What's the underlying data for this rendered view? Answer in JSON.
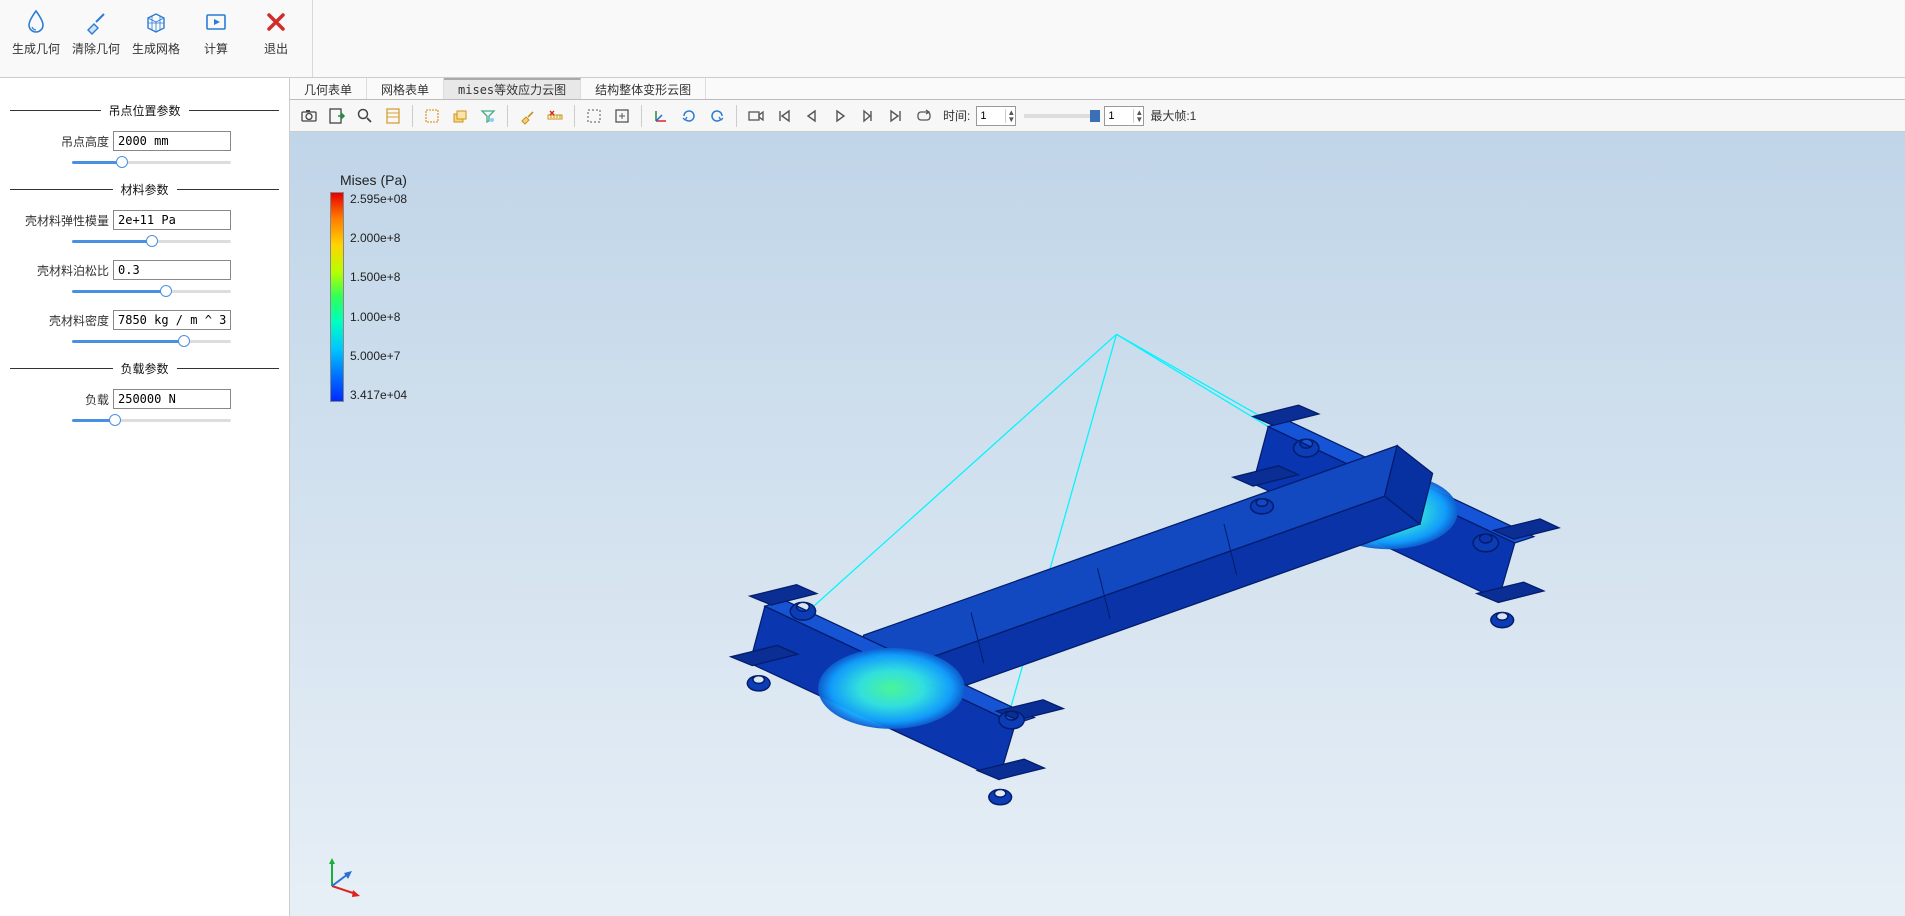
{
  "ribbon": {
    "generate_geom": "生成几何",
    "clear_geom": "清除几何",
    "generate_mesh": "生成网格",
    "compute": "计算",
    "exit": "退出"
  },
  "sidebar": {
    "group1_title": "吊点位置参数",
    "hang_height_label": "吊点高度",
    "hang_height_value": "2000 mm",
    "group2_title": "材料参数",
    "elastic_label": "壳材料弹性模量",
    "elastic_value": "2e+11 Pa",
    "poisson_label": "壳材料泊松比",
    "poisson_value": "0.3",
    "density_label": "壳材料密度",
    "density_value": "7850 kg / m ^ 3",
    "group3_title": "负载参数",
    "load_label": "负载",
    "load_value": "250000 N"
  },
  "tabs": {
    "t1": "几何表单",
    "t2": "网格表单",
    "t3": "mises等效应力云图",
    "t4": "结构整体变形云图"
  },
  "vtoolbar": {
    "time_label": "时间:",
    "spin1": "1",
    "spin2": "1",
    "maxframe": "最大帧:1"
  },
  "legend": {
    "title": "Mises (Pa)",
    "t0": "2.595e+08",
    "t1": "2.000e+8",
    "t2": "1.500e+8",
    "t3": "1.000e+8",
    "t4": "5.000e+7",
    "t5": "3.417e+04"
  },
  "chart_data": {
    "type": "heatmap",
    "title": "Mises (Pa)",
    "colormap": "rainbow",
    "range": [
      34170.0,
      259500000.0
    ],
    "ticks": [
      259500000.0,
      200000000.0,
      150000000.0,
      100000000.0,
      50000000.0,
      34170.0
    ],
    "description": "Von Mises equivalent stress contour plot on a structural lifting beam (H-beam spreader) with four lifting lugs. Stress concentrations appear near Y-joint connections between cross beams and main beam (cyan-green regions ~5e7-1e8 Pa); most of the structure is low stress (deep blue ~3e4-5e7 Pa). Thin cyan lines indicate rigid link / cable elements from a single lift point above to the four lugs."
  }
}
